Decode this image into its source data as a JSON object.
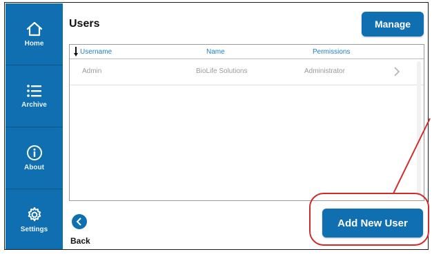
{
  "sidebar": {
    "items": [
      {
        "label": "Home",
        "icon": "home-icon"
      },
      {
        "label": "Archive",
        "icon": "list-icon"
      },
      {
        "label": "About",
        "icon": "info-icon"
      },
      {
        "label": "Settings",
        "icon": "gear-icon"
      }
    ]
  },
  "page": {
    "title": "Users"
  },
  "toolbar": {
    "manage_label": "Manage",
    "add_user_label": "Add New User"
  },
  "table": {
    "columns": [
      "Username",
      "Name",
      "Permissions"
    ],
    "sort_icon": "sort-down-icon",
    "rows": [
      {
        "username": "Admin",
        "name": "BioLife Solutions",
        "permissions": "Administrator"
      }
    ]
  },
  "footer": {
    "back_label": "Back"
  },
  "colors": {
    "accent": "#0f6fb0",
    "highlight": "#d22a2a"
  }
}
